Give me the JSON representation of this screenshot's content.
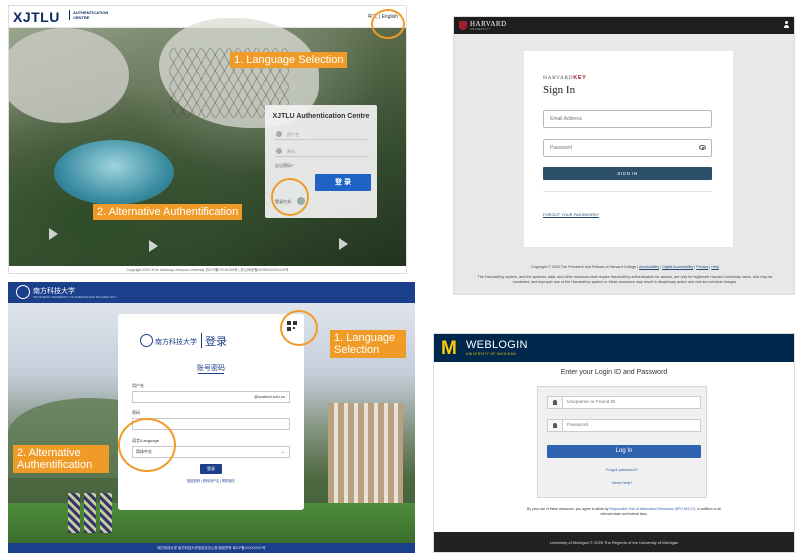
{
  "xjtlu": {
    "logo": "XJTLU",
    "logo_sub": "AUTHENTICATION CENTRE",
    "language_switch": "中文 | English",
    "card_title": "XJTLU Authentication Centre",
    "username_placeholder": "用户名",
    "password_placeholder": "密码",
    "forgot_password": "忘记密码?",
    "login_button": "登 录",
    "alt_method_label": "登录方式:",
    "footer": "Copyright 2020 Xi'an Jiaotong-Liverpool University 苏ICP备07016150号 | 苏公网安备32059002002419号",
    "annotation_language": "1. Language Selection",
    "annotation_alt": "2. Alternative Authentification"
  },
  "harvard": {
    "brand": "HARVARD",
    "brand_sub": "UNIVERSITY",
    "key_label_a": "HARVARD",
    "key_label_b": "KEY",
    "title": "Sign In",
    "email_placeholder": "Email Address",
    "password_placeholder": "Password",
    "signin_button": "SIGN IN",
    "forgot_password": "FORGOT YOUR PASSWORD?",
    "copyright": "Copyright © 2025 The President and Fellows of Harvard College |",
    "links": [
      "Accessibility",
      "Digital Accessibility",
      "Privacy",
      "Help"
    ],
    "legal": "The HarvardKey system, and the systems, data, and other resources that require HarvardKey authentication for access, are only for legitimate Harvard University users. Use may be monitored, and improper use of the HarvardKey system or these resources may result in disciplinary action and civil and criminal charges."
  },
  "sustech": {
    "header_name": "南方科技大学",
    "header_sub": "SOUTHERN UNIVERSITY OF SCIENCE AND TECHNOLOGY",
    "card_name": "南方科技大学",
    "card_title": "登录",
    "tab": "账号密码",
    "username_label": "用户名",
    "username_suffix": "@sustech.edu.cn",
    "password_label": "密码",
    "language_label": "语言/Language",
    "language_value": "简体中文",
    "login_button": "登录",
    "links": "找回密码 | 修改用户名 | 帮助指引",
    "footer": "南方科技大学 南方科技大学信息化办公室 版权所有 粤ICP备XXXXXXXX号",
    "annotation_language": "1. Language Selection",
    "annotation_alt": "2. Alternative Authentification"
  },
  "michigan": {
    "logo_m": "M",
    "brand": "WEBLOGIN",
    "brand_sub": "UNIVERSITY OF MICHIGAN",
    "heading": "Enter your Login ID and Password",
    "uniqname_placeholder": "Uniqname or Friend ID",
    "password_placeholder": "Password",
    "login_button": "Log In",
    "forgot_password": "Forgot password?",
    "need_help": "Need help?",
    "terms_a": "By your use of these resources, you agree to abide by",
    "terms_link": "Responsible Use of Information Resources (SPG 601.07)",
    "terms_b": ", in addition to all relevant state and federal laws.",
    "footer": "University of Michigan  © 2025 The Regents of the University of Michigan"
  },
  "colors": {
    "annotation": "#f09b27",
    "xjtlu_button": "#1f63c6",
    "harvard_crimson": "#a51c30",
    "harvard_button": "#2c4f6a",
    "sustech_blue": "#1c3f8c",
    "michigan_blue": "#00274c",
    "michigan_maize": "#ffcb05"
  }
}
